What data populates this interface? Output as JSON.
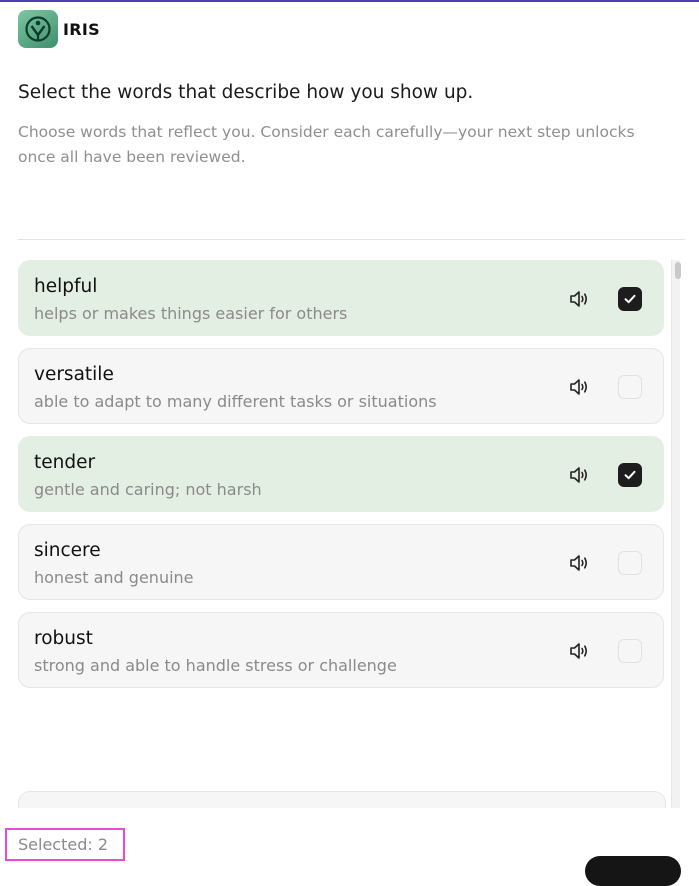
{
  "app": {
    "name": "IRIS"
  },
  "prompt": {
    "heading": "Select the words that describe how you show up.",
    "subtitle": "Choose words that reflect you. Consider each carefully—your next step unlocks once all have been reviewed."
  },
  "words": [
    {
      "word": "helpful",
      "definition": "helps or makes things easier for others",
      "selected": true
    },
    {
      "word": "versatile",
      "definition": "able to adapt to many different tasks or situations",
      "selected": false
    },
    {
      "word": "tender",
      "definition": "gentle and caring; not harsh",
      "selected": true
    },
    {
      "word": "sincere",
      "definition": "honest and genuine",
      "selected": false
    },
    {
      "word": "robust",
      "definition": "strong and able to handle stress or challenge",
      "selected": false
    }
  ],
  "footer": {
    "selected_label": "Selected: 2"
  },
  "icons": {
    "logo": "iris-logo-icon",
    "speaker": "speaker-icon",
    "check": "check-icon"
  },
  "colors": {
    "selected_card": "#e4efe3",
    "checkbox_checked": "#1d1d1d",
    "brand": "#3f8f6c",
    "highlight": "#e94bd8"
  }
}
